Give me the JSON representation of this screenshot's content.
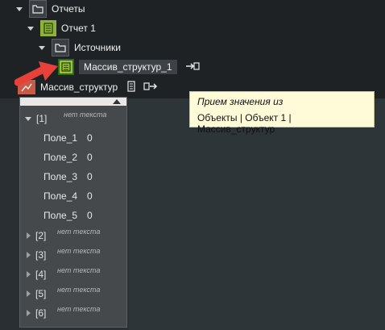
{
  "tree": {
    "items": [
      {
        "label": "Отчеты"
      },
      {
        "label": "Отчет 1"
      },
      {
        "label": "Источники"
      },
      {
        "label": "Массив_структур_1"
      }
    ],
    "source_row": {
      "label": "Массив_структур"
    }
  },
  "tooltip": {
    "line1": "Прием значения из",
    "line2": "Объекты | Объект 1 | Массив_структур"
  },
  "panel": {
    "empty_text": "нет текста",
    "expanded_index": "[1]",
    "fields": [
      {
        "name": "Поле_1",
        "value": "0"
      },
      {
        "name": "Поле_2",
        "value": "0"
      },
      {
        "name": "Поле_3",
        "value": "0"
      },
      {
        "name": "Поле_4",
        "value": "0"
      },
      {
        "name": "Поле_5",
        "value": "0"
      }
    ],
    "collapsed": [
      {
        "index": "[2]",
        "text": "нет текста"
      },
      {
        "index": "[3]",
        "text": "нет текста"
      },
      {
        "index": "[4]",
        "text": "нет текста"
      },
      {
        "index": "[5]",
        "text": "нет текста"
      },
      {
        "index": "[6]",
        "text": "нет текста"
      }
    ]
  },
  "colors": {
    "accent_green": "#9cc13c",
    "arrow_red": "#e8413a",
    "tooltip_bg": "#fffbd9"
  }
}
